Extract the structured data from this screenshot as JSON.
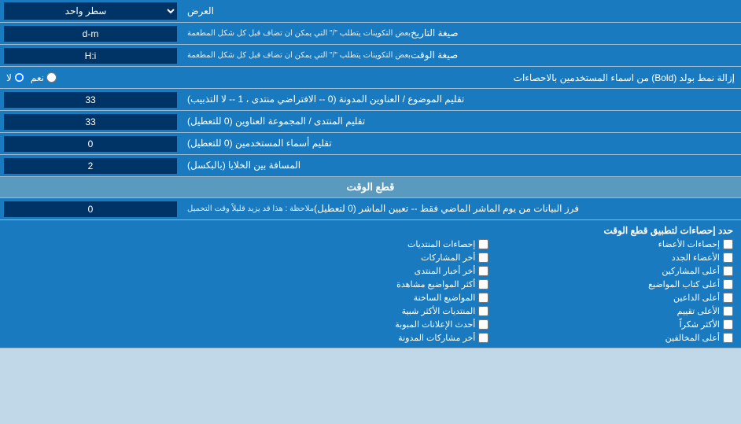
{
  "page": {
    "title": "العرض",
    "sections": {
      "top": {
        "label": "العرض",
        "select_value": "سطر واحد"
      },
      "date_format": {
        "label": "صيغة التاريخ",
        "sublabel": "بعض التكوينات يتطلب \"/\" التي يمكن ان تضاف قبل كل شكل المطعمة",
        "value": "d-m"
      },
      "time_format": {
        "label": "صيغة الوقت",
        "sublabel": "بعض التكوينات يتطلب \"/\" التي يمكن ان تضاف قبل كل شكل المطعمة",
        "value": "H:i"
      },
      "bold_remove": {
        "label": "إزالة نمط بولد (Bold) من اسماء المستخدمين بالاحصاءات",
        "radio_yes": "نعم",
        "radio_no": "لا",
        "selected": "no"
      },
      "topics_limit": {
        "label": "تقليم الموضوع / العناوين المدونة (0 -- الافتراضي منتدى ، 1 -- لا التذبيب)",
        "value": "33"
      },
      "forum_limit": {
        "label": "تقليم المنتدى / المجموعة العناوين (0 للتعطيل)",
        "value": "33"
      },
      "users_limit": {
        "label": "تقليم أسماء المستخدمين (0 للتعطيل)",
        "value": "0"
      },
      "cell_spacing": {
        "label": "المسافة بين الخلايا (بالبكسل)",
        "value": "2"
      },
      "time_cut_section": {
        "header": "قطع الوقت"
      },
      "time_cut": {
        "label": "فرز البيانات من يوم الماشر الماضي فقط -- تعيين الماشر (0 لتعطيل)",
        "sublabel": "ملاحظة : هذا قد يزيد قليلاً وقت التحميل",
        "value": "0"
      },
      "stats_section": {
        "header": "حدد إحصاءات لتطبيق قطع الوقت",
        "col1_header": "إحصاءات الأعضاء",
        "col2_header": "إحصاءات المنتديات",
        "col3_header": ""
      },
      "checkboxes": {
        "col1": [
          {
            "label": "إحصاءات الأعضاء",
            "checked": false
          },
          {
            "label": "الأعضاء الجدد",
            "checked": false
          },
          {
            "label": "أعلى المشاركين",
            "checked": false
          },
          {
            "label": "أعلى كتاب المواضيع",
            "checked": false
          },
          {
            "label": "أعلى الداعين",
            "checked": false
          },
          {
            "label": "الأعلى تقييم",
            "checked": false
          },
          {
            "label": "الأكثر شكراً",
            "checked": false
          },
          {
            "label": "أعلى المخالفين",
            "checked": false
          }
        ],
        "col2": [
          {
            "label": "إحصاءات المنتديات",
            "checked": false
          },
          {
            "label": "أخر المشاركات",
            "checked": false
          },
          {
            "label": "أخر أخبار المنتدى",
            "checked": false
          },
          {
            "label": "أكثر المواضيع مشاهدة",
            "checked": false
          },
          {
            "label": "المواضيع الساخنة",
            "checked": false
          },
          {
            "label": "المنتديات الأكثر شبية",
            "checked": false
          },
          {
            "label": "أحدث الإعلانات المبوبة",
            "checked": false
          },
          {
            "label": "أخر مشاركات المدونة",
            "checked": false
          }
        ],
        "col3": [
          {
            "label": "إحصاءات الأعضاء",
            "checked": false
          },
          {
            "label": "الأعضاء الجدد",
            "checked": false
          },
          {
            "label": "أعلى المشاركين",
            "checked": false
          },
          {
            "label": "أعلى كتاب المواضيع",
            "checked": false
          },
          {
            "label": "أعلى الداعين",
            "checked": false
          },
          {
            "label": "الأعلى تقييم",
            "checked": false
          },
          {
            "label": "الأكثر شكراً",
            "checked": false
          },
          {
            "label": "أعلى المخالفين",
            "checked": false
          }
        ]
      }
    }
  }
}
